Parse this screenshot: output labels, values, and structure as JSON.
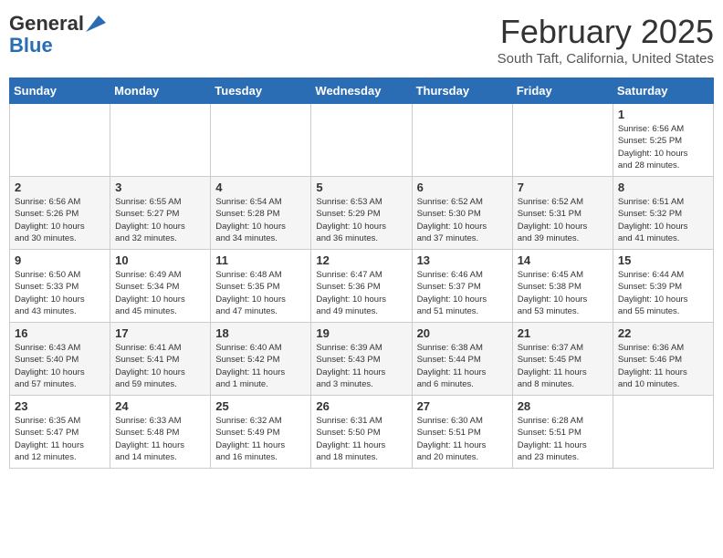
{
  "header": {
    "logo_general": "General",
    "logo_blue": "Blue",
    "month_title": "February 2025",
    "location": "South Taft, California, United States"
  },
  "days_of_week": [
    "Sunday",
    "Monday",
    "Tuesday",
    "Wednesday",
    "Thursday",
    "Friday",
    "Saturday"
  ],
  "weeks": [
    [
      {
        "day": "",
        "info": ""
      },
      {
        "day": "",
        "info": ""
      },
      {
        "day": "",
        "info": ""
      },
      {
        "day": "",
        "info": ""
      },
      {
        "day": "",
        "info": ""
      },
      {
        "day": "",
        "info": ""
      },
      {
        "day": "1",
        "info": "Sunrise: 6:56 AM\nSunset: 5:25 PM\nDaylight: 10 hours\nand 28 minutes."
      }
    ],
    [
      {
        "day": "2",
        "info": "Sunrise: 6:56 AM\nSunset: 5:26 PM\nDaylight: 10 hours\nand 30 minutes."
      },
      {
        "day": "3",
        "info": "Sunrise: 6:55 AM\nSunset: 5:27 PM\nDaylight: 10 hours\nand 32 minutes."
      },
      {
        "day": "4",
        "info": "Sunrise: 6:54 AM\nSunset: 5:28 PM\nDaylight: 10 hours\nand 34 minutes."
      },
      {
        "day": "5",
        "info": "Sunrise: 6:53 AM\nSunset: 5:29 PM\nDaylight: 10 hours\nand 36 minutes."
      },
      {
        "day": "6",
        "info": "Sunrise: 6:52 AM\nSunset: 5:30 PM\nDaylight: 10 hours\nand 37 minutes."
      },
      {
        "day": "7",
        "info": "Sunrise: 6:52 AM\nSunset: 5:31 PM\nDaylight: 10 hours\nand 39 minutes."
      },
      {
        "day": "8",
        "info": "Sunrise: 6:51 AM\nSunset: 5:32 PM\nDaylight: 10 hours\nand 41 minutes."
      }
    ],
    [
      {
        "day": "9",
        "info": "Sunrise: 6:50 AM\nSunset: 5:33 PM\nDaylight: 10 hours\nand 43 minutes."
      },
      {
        "day": "10",
        "info": "Sunrise: 6:49 AM\nSunset: 5:34 PM\nDaylight: 10 hours\nand 45 minutes."
      },
      {
        "day": "11",
        "info": "Sunrise: 6:48 AM\nSunset: 5:35 PM\nDaylight: 10 hours\nand 47 minutes."
      },
      {
        "day": "12",
        "info": "Sunrise: 6:47 AM\nSunset: 5:36 PM\nDaylight: 10 hours\nand 49 minutes."
      },
      {
        "day": "13",
        "info": "Sunrise: 6:46 AM\nSunset: 5:37 PM\nDaylight: 10 hours\nand 51 minutes."
      },
      {
        "day": "14",
        "info": "Sunrise: 6:45 AM\nSunset: 5:38 PM\nDaylight: 10 hours\nand 53 minutes."
      },
      {
        "day": "15",
        "info": "Sunrise: 6:44 AM\nSunset: 5:39 PM\nDaylight: 10 hours\nand 55 minutes."
      }
    ],
    [
      {
        "day": "16",
        "info": "Sunrise: 6:43 AM\nSunset: 5:40 PM\nDaylight: 10 hours\nand 57 minutes."
      },
      {
        "day": "17",
        "info": "Sunrise: 6:41 AM\nSunset: 5:41 PM\nDaylight: 10 hours\nand 59 minutes."
      },
      {
        "day": "18",
        "info": "Sunrise: 6:40 AM\nSunset: 5:42 PM\nDaylight: 11 hours\nand 1 minute."
      },
      {
        "day": "19",
        "info": "Sunrise: 6:39 AM\nSunset: 5:43 PM\nDaylight: 11 hours\nand 3 minutes."
      },
      {
        "day": "20",
        "info": "Sunrise: 6:38 AM\nSunset: 5:44 PM\nDaylight: 11 hours\nand 6 minutes."
      },
      {
        "day": "21",
        "info": "Sunrise: 6:37 AM\nSunset: 5:45 PM\nDaylight: 11 hours\nand 8 minutes."
      },
      {
        "day": "22",
        "info": "Sunrise: 6:36 AM\nSunset: 5:46 PM\nDaylight: 11 hours\nand 10 minutes."
      }
    ],
    [
      {
        "day": "23",
        "info": "Sunrise: 6:35 AM\nSunset: 5:47 PM\nDaylight: 11 hours\nand 12 minutes."
      },
      {
        "day": "24",
        "info": "Sunrise: 6:33 AM\nSunset: 5:48 PM\nDaylight: 11 hours\nand 14 minutes."
      },
      {
        "day": "25",
        "info": "Sunrise: 6:32 AM\nSunset: 5:49 PM\nDaylight: 11 hours\nand 16 minutes."
      },
      {
        "day": "26",
        "info": "Sunrise: 6:31 AM\nSunset: 5:50 PM\nDaylight: 11 hours\nand 18 minutes."
      },
      {
        "day": "27",
        "info": "Sunrise: 6:30 AM\nSunset: 5:51 PM\nDaylight: 11 hours\nand 20 minutes."
      },
      {
        "day": "28",
        "info": "Sunrise: 6:28 AM\nSunset: 5:51 PM\nDaylight: 11 hours\nand 23 minutes."
      },
      {
        "day": "",
        "info": ""
      }
    ]
  ]
}
